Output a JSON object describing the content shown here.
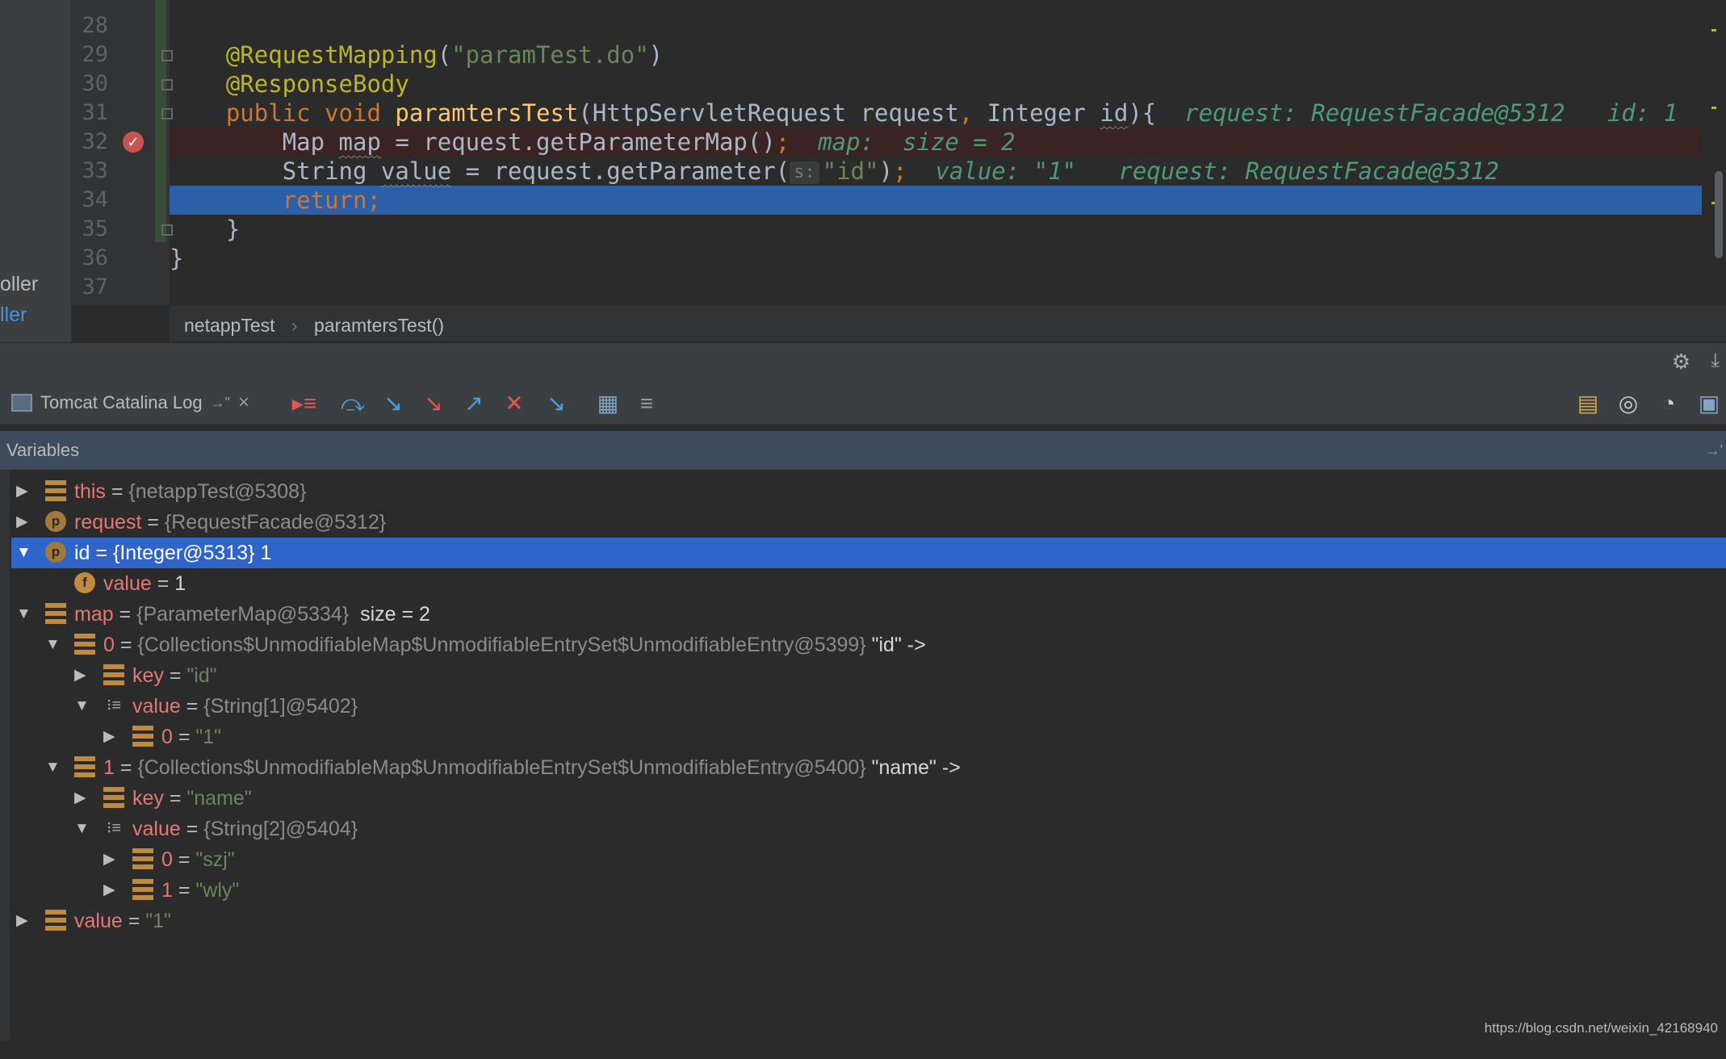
{
  "editor": {
    "lines": [
      {
        "num": "28"
      },
      {
        "num": "29",
        "annotation": "@RequestMapping",
        "open": "(",
        "arg": "\"paramTest.do\"",
        "close": ")"
      },
      {
        "num": "30",
        "annotation": "@ResponseBody"
      },
      {
        "num": "31",
        "kw1": "public",
        "kw2": "void",
        "method": "paramtersTest",
        "p_open": "(HttpServletRequest request",
        "comma": ",",
        "p2": " Integer ",
        "p2name": "id",
        "p_close": "){",
        "inline": "request: RequestFacade@5312   id: 1"
      },
      {
        "num": "32",
        "t1": "Map ",
        "var": "map",
        "t2": " = request.getParameterMap()",
        "semi": ";",
        "inline": "map:  size = 2"
      },
      {
        "num": "33",
        "t1": "String ",
        "var": "value",
        "t2": " = request.getParameter(",
        "hint": "s:",
        "str": "\"id\"",
        "t3": ")",
        "semi": ";",
        "inline": "value: \"1\"   request: RequestFacade@5312"
      },
      {
        "num": "34",
        "kw": "return",
        "semi": ";"
      },
      {
        "num": "35",
        "brace": "}"
      },
      {
        "num": "36",
        "brace": "}"
      },
      {
        "num": "37"
      }
    ],
    "project_labels": [
      "oller",
      "ller"
    ]
  },
  "breadcrumb": {
    "class_name": "netappTest",
    "separator": "›",
    "method_name": "paramtersTest()"
  },
  "debug": {
    "tab_label": "Tomcat Catalina Log",
    "tab_pin": "→\"",
    "tab_close": "×",
    "variables_title": "Variables",
    "variables_pin": "→'"
  },
  "variables": [
    {
      "name": "this",
      "eq": " = ",
      "value": "{netappTest@5308}"
    },
    {
      "name": "request",
      "eq": " = ",
      "value": "{RequestFacade@5312}"
    },
    {
      "name": "id",
      "eq": " = ",
      "value": "{Integer@5313} 1"
    },
    {
      "name": "value",
      "eq": " = ",
      "value": "1"
    },
    {
      "name": "map",
      "eq": " = ",
      "value": "{ParameterMap@5334}",
      "extra": "  size = 2"
    },
    {
      "name": "0",
      "eq": " = ",
      "value": "{Collections$UnmodifiableMap$UnmodifiableEntrySet$UnmodifiableEntry@5399}",
      "extra": " \"id\" ->"
    },
    {
      "name": "key",
      "eq": " = ",
      "value": "\"id\""
    },
    {
      "name": "value",
      "eq": " = ",
      "value": "{String[1]@5402}"
    },
    {
      "name": "0",
      "eq": " = ",
      "value": "\"1\""
    },
    {
      "name": "1",
      "eq": " = ",
      "value": "{Collections$UnmodifiableMap$UnmodifiableEntrySet$UnmodifiableEntry@5400}",
      "extra": " \"name\" ->"
    },
    {
      "name": "key",
      "eq": " = ",
      "value": "\"name\""
    },
    {
      "name": "value",
      "eq": " = ",
      "value": "{String[2]@5404}"
    },
    {
      "name": "0",
      "eq": " = ",
      "value": "\"szj\""
    },
    {
      "name": "1",
      "eq": " = ",
      "value": "\"wly\""
    },
    {
      "name": "value",
      "eq": " = ",
      "value": "\"1\""
    }
  ],
  "icons": {
    "expanded": "▼",
    "collapsed": "▶",
    "param_letter": "p",
    "final_letter": "f"
  },
  "colors": {
    "selection": "#2f65ca",
    "breakpoint_line": "#3a2323",
    "execution_line": "#2d5fa8",
    "var_name": "#e37874"
  },
  "watermark": "https://blog.csdn.net/weixin_42168940"
}
